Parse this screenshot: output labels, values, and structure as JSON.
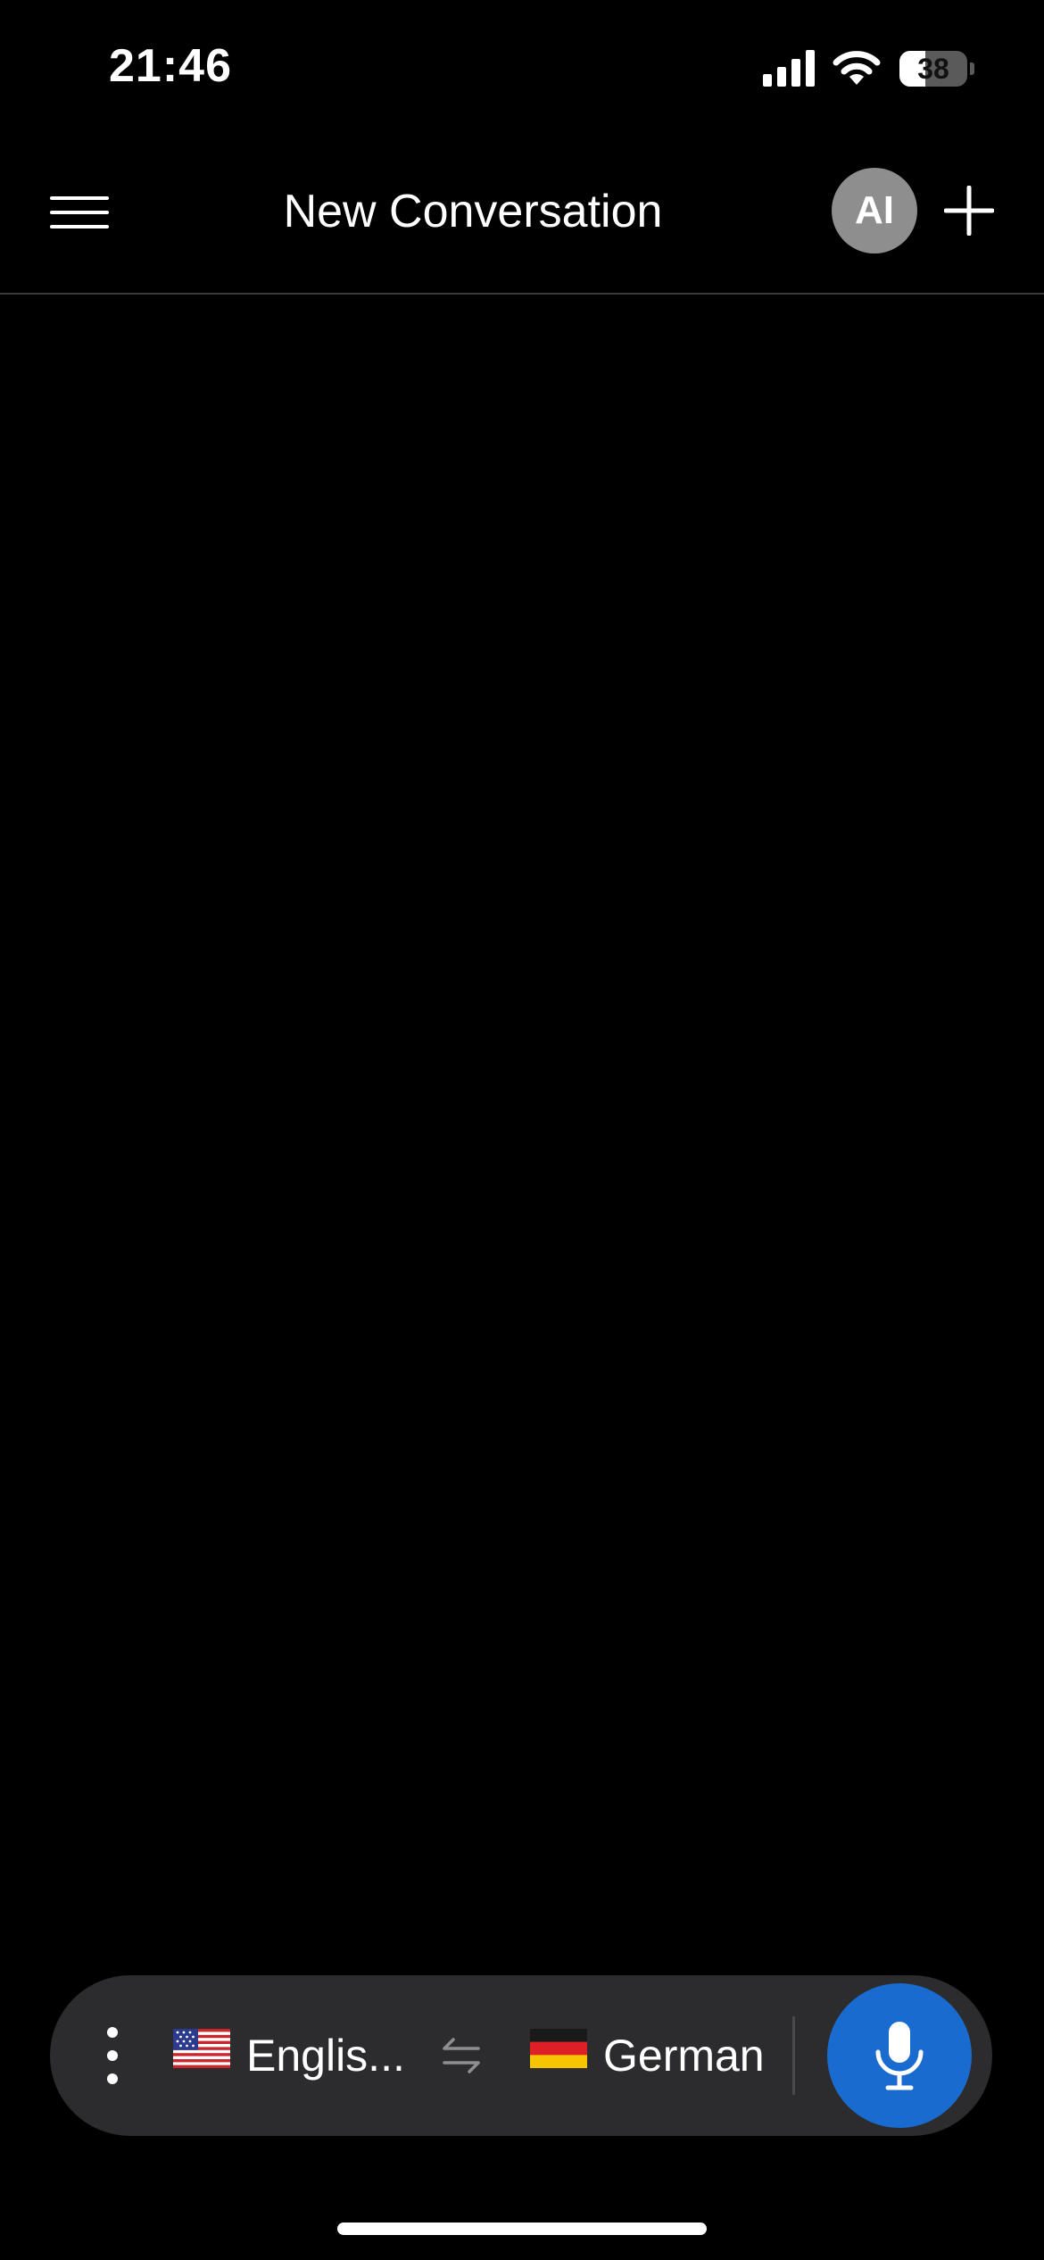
{
  "status_bar": {
    "time": "21:46",
    "battery_level": "38",
    "battery_fraction": 0.38,
    "signal_icon": "cellular-signal-icon",
    "wifi_icon": "wifi-icon"
  },
  "nav": {
    "menu_icon": "hamburger-menu-icon",
    "title": "New Conversation",
    "avatar_label": "AI",
    "add_icon": "plus-icon"
  },
  "language_bar": {
    "more_icon": "vertical-ellipsis-icon",
    "source_language": {
      "label": "Englis...",
      "flag_icon": "us-flag-icon"
    },
    "swap_icon": "swap-arrows-icon",
    "target_language": {
      "label": "German",
      "flag_icon": "germany-flag-icon"
    },
    "mic_icon": "microphone-icon"
  },
  "colors": {
    "background": "#000000",
    "bar_background": "#2c2c2e",
    "mic_button": "#1a6bd0",
    "avatar": "#8e8e8e"
  }
}
